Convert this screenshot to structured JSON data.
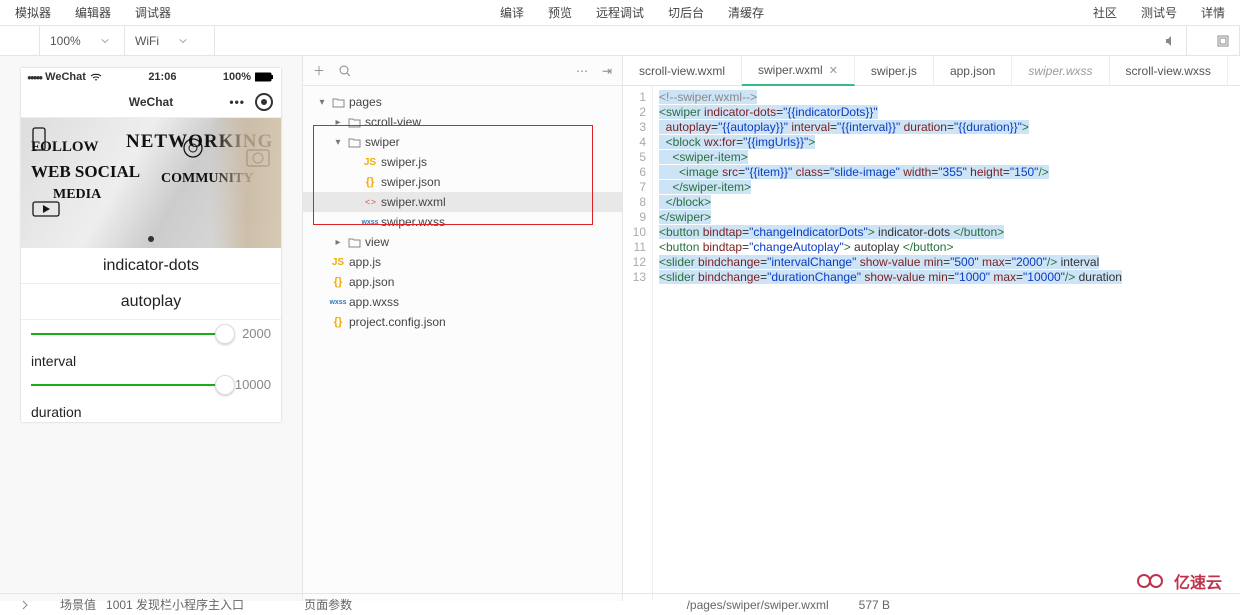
{
  "top_menu_left": [
    "模拟器",
    "编辑器",
    "调试器"
  ],
  "top_menu_mid": [
    "编译",
    "预览",
    "远程调试",
    "切后台",
    "清缓存"
  ],
  "top_menu_right": [
    "社区",
    "测试号",
    "详情"
  ],
  "subbar": {
    "zoom": "100%",
    "network": "WiFi",
    "device_sel": ""
  },
  "simulator": {
    "carrier": "WeChat",
    "signal": "●●●●●",
    "wifi": "wifi",
    "time": "21:06",
    "battery": "100%",
    "nav_title": "WeChat",
    "img_words": {
      "t1": "FOLLOW",
      "t2": "WEB  SOCIAL",
      "t3": "MEDIA",
      "t4": "NETWORKING",
      "t5": "COMMUNITY"
    },
    "btn1": "indicator-dots",
    "btn2": "autoplay",
    "interval_label": "interval",
    "interval_value": "2000",
    "duration_label": "duration",
    "duration_value": "10000"
  },
  "tree": [
    {
      "depth": 0,
      "caret": "▾",
      "type": "folder",
      "name": "pages"
    },
    {
      "depth": 1,
      "caret": "▸",
      "type": "folder",
      "name": "scroll-view"
    },
    {
      "depth": 1,
      "caret": "▾",
      "type": "folder",
      "name": "swiper"
    },
    {
      "depth": 2,
      "caret": "",
      "type": "js",
      "name": "swiper.js"
    },
    {
      "depth": 2,
      "caret": "",
      "type": "json",
      "name": "swiper.json"
    },
    {
      "depth": 2,
      "caret": "",
      "type": "wxml",
      "name": "swiper.wxml",
      "sel": true
    },
    {
      "depth": 2,
      "caret": "",
      "type": "wxss",
      "name": "swiper.wxss"
    },
    {
      "depth": 1,
      "caret": "▸",
      "type": "folder",
      "name": "view"
    },
    {
      "depth": 0,
      "caret": "",
      "type": "js",
      "name": "app.js"
    },
    {
      "depth": 0,
      "caret": "",
      "type": "json",
      "name": "app.json"
    },
    {
      "depth": 0,
      "caret": "",
      "type": "wxss",
      "name": "app.wxss"
    },
    {
      "depth": 0,
      "caret": "",
      "type": "json",
      "name": "project.config.json"
    }
  ],
  "tabs": [
    {
      "name": "scroll-view.wxml",
      "active": false
    },
    {
      "name": "swiper.wxml",
      "active": true,
      "close": true
    },
    {
      "name": "swiper.js",
      "active": false
    },
    {
      "name": "app.json",
      "active": false
    },
    {
      "name": "swiper.wxss",
      "active": false,
      "ital": true
    },
    {
      "name": "scroll-view.wxss",
      "active": false
    }
  ],
  "code": [
    {
      "n": 1,
      "hl": true,
      "seg": [
        [
          "cmt",
          "<!--swiper.wxml-->"
        ]
      ]
    },
    {
      "n": 2,
      "hl": true,
      "seg": [
        [
          "tag",
          "<swiper"
        ],
        [
          "txt",
          " "
        ],
        [
          "attr",
          "indicator-dots"
        ],
        [
          "txt",
          "="
        ],
        [
          "str",
          "\"{{indicatorDots}}\""
        ]
      ]
    },
    {
      "n": 3,
      "hl": true,
      "seg": [
        [
          "txt",
          "  "
        ],
        [
          "attr",
          "autoplay"
        ],
        [
          "txt",
          "="
        ],
        [
          "str",
          "\"{{autoplay}}\""
        ],
        [
          "txt",
          " "
        ],
        [
          "attr",
          "interval"
        ],
        [
          "txt",
          "="
        ],
        [
          "str",
          "\"{{interval}}\""
        ],
        [
          "txt",
          " "
        ],
        [
          "attr",
          "duration"
        ],
        [
          "txt",
          "="
        ],
        [
          "str",
          "\"{{duration}}\""
        ],
        [
          "tag",
          ">"
        ]
      ]
    },
    {
      "n": 4,
      "hl": true,
      "seg": [
        [
          "txt",
          "  "
        ],
        [
          "tag",
          "<block"
        ],
        [
          "txt",
          " "
        ],
        [
          "attr",
          "wx:for"
        ],
        [
          "txt",
          "="
        ],
        [
          "str",
          "\"{{imgUrls}}\""
        ],
        [
          "tag",
          ">"
        ]
      ]
    },
    {
      "n": 5,
      "hl": true,
      "seg": [
        [
          "txt",
          "    "
        ],
        [
          "tag",
          "<swiper-item>"
        ]
      ]
    },
    {
      "n": 6,
      "hl": true,
      "seg": [
        [
          "txt",
          "      "
        ],
        [
          "tag",
          "<image"
        ],
        [
          "txt",
          " "
        ],
        [
          "attr",
          "src"
        ],
        [
          "txt",
          "="
        ],
        [
          "str",
          "\"{{item}}\""
        ],
        [
          "txt",
          " "
        ],
        [
          "attr",
          "class"
        ],
        [
          "txt",
          "="
        ],
        [
          "str",
          "\"slide-image\""
        ],
        [
          "txt",
          " "
        ],
        [
          "attr",
          "width"
        ],
        [
          "txt",
          "="
        ],
        [
          "str",
          "\"355\""
        ],
        [
          "txt",
          " "
        ],
        [
          "attr",
          "height"
        ],
        [
          "txt",
          "="
        ],
        [
          "str",
          "\"150\""
        ],
        [
          "tag",
          "/>"
        ]
      ]
    },
    {
      "n": 7,
      "hl": true,
      "seg": [
        [
          "txt",
          "    "
        ],
        [
          "tag",
          "</swiper-item>"
        ]
      ]
    },
    {
      "n": 8,
      "hl": true,
      "seg": [
        [
          "txt",
          "  "
        ],
        [
          "tag",
          "</block>"
        ]
      ]
    },
    {
      "n": 9,
      "hl": true,
      "seg": [
        [
          "tag",
          "</swiper>"
        ]
      ]
    },
    {
      "n": 10,
      "hl": true,
      "seg": [
        [
          "tag",
          "<button"
        ],
        [
          "txt",
          " "
        ],
        [
          "attr",
          "bindtap"
        ],
        [
          "txt",
          "="
        ],
        [
          "str",
          "\"changeIndicatorDots\""
        ],
        [
          "tag",
          ">"
        ],
        [
          "txt",
          " indicator-dots "
        ],
        [
          "tag",
          "</button>"
        ]
      ]
    },
    {
      "n": 11,
      "hl": false,
      "seg": [
        [
          "tag",
          "<button"
        ],
        [
          "txt",
          " "
        ],
        [
          "attr",
          "bindtap"
        ],
        [
          "txt",
          "="
        ],
        [
          "str",
          "\"changeAutoplay\""
        ],
        [
          "tag",
          ">"
        ],
        [
          "txt",
          " autoplay "
        ],
        [
          "tag",
          "</button>"
        ]
      ]
    },
    {
      "n": 12,
      "hl": true,
      "seg": [
        [
          "tag",
          "<slider"
        ],
        [
          "txt",
          " "
        ],
        [
          "attr",
          "bindchange"
        ],
        [
          "txt",
          "="
        ],
        [
          "str",
          "\"intervalChange\""
        ],
        [
          "txt",
          " "
        ],
        [
          "attr",
          "show-value"
        ],
        [
          "txt",
          " "
        ],
        [
          "attr",
          "min"
        ],
        [
          "txt",
          "="
        ],
        [
          "str",
          "\"500\""
        ],
        [
          "txt",
          " "
        ],
        [
          "attr",
          "max"
        ],
        [
          "txt",
          "="
        ],
        [
          "str",
          "\"2000\""
        ],
        [
          "tag",
          "/>"
        ],
        [
          "txt",
          " interval"
        ]
      ]
    },
    {
      "n": 13,
      "hl": true,
      "seg": [
        [
          "tag",
          "<slider"
        ],
        [
          "txt",
          " "
        ],
        [
          "attr",
          "bindchange"
        ],
        [
          "txt",
          "="
        ],
        [
          "str",
          "\"durationChange\""
        ],
        [
          "txt",
          " "
        ],
        [
          "attr",
          "show-value"
        ],
        [
          "txt",
          " "
        ],
        [
          "attr",
          "min"
        ],
        [
          "txt",
          "="
        ],
        [
          "str",
          "\"1000\""
        ],
        [
          "txt",
          " "
        ],
        [
          "attr",
          "max"
        ],
        [
          "txt",
          "="
        ],
        [
          "str",
          "\"10000\""
        ],
        [
          "tag",
          "/>"
        ],
        [
          "txt",
          " duration"
        ]
      ]
    }
  ],
  "status": {
    "scene_label": "场景值",
    "scene": "1001 发现栏小程序主入口",
    "page_param": "页面参数",
    "filepath": "/pages/swiper/swiper.wxml",
    "filesize": "577 B"
  },
  "watermark": "亿速云"
}
